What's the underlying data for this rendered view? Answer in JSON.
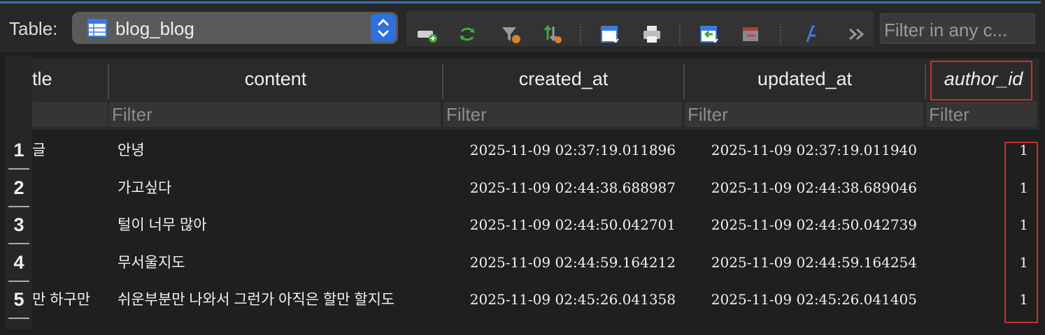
{
  "toolbar": {
    "table_label": "Table:",
    "table_name": "blog_blog",
    "filter_placeholder": "Filter in any c..."
  },
  "columns": [
    "tle",
    "content",
    "created_at",
    "updated_at",
    "author_id"
  ],
  "filter_placeholder": "Filter",
  "rows": [
    {
      "num": "1",
      "title": "글",
      "content": "안녕",
      "created_at": "2025-11-09 02:37:19.011896",
      "updated_at": "2025-11-09 02:37:19.011940",
      "author_id": "1"
    },
    {
      "num": "2",
      "title": "",
      "content": "가고싶다",
      "created_at": "2025-11-09 02:44:38.688987",
      "updated_at": "2025-11-09 02:44:38.689046",
      "author_id": "1"
    },
    {
      "num": "3",
      "title": "",
      "content": "털이 너무 많아",
      "created_at": "2025-11-09 02:44:50.042701",
      "updated_at": "2025-11-09 02:44:50.042739",
      "author_id": "1"
    },
    {
      "num": "4",
      "title": "",
      "content": "무서울지도",
      "created_at": "2025-11-09 02:44:59.164212",
      "updated_at": "2025-11-09 02:44:59.164254",
      "author_id": "1"
    },
    {
      "num": "5",
      "title": "만 하구만",
      "content": "쉬운부분만 나와서 그런가 아직은 할만 할지도",
      "created_at": "2025-11-09 02:45:26.041358",
      "updated_at": "2025-11-09 02:45:26.041405",
      "author_id": "1"
    }
  ],
  "colors": {
    "accent": "#2f6fe0",
    "highlight": "#c9302c",
    "background": "#1e1e1e"
  }
}
